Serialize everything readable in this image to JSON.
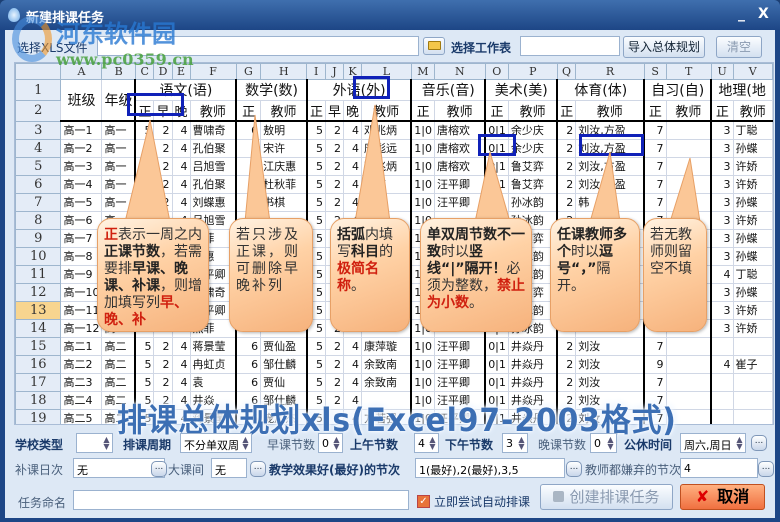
{
  "window": {
    "title": "新建排课任务",
    "minimize": "_",
    "close": "X"
  },
  "watermark": {
    "logo_text": "河东软件园",
    "logo_url": "www.pc0359.cn",
    "overlay": "排课总体规划xls(Excel97-2003格式)"
  },
  "toolbar": {
    "file_label": "选择XLS文件",
    "file_value": "",
    "sheet_label": "选择工作表",
    "sheet_value": "",
    "import_button": "导入总体规划",
    "clear_button": "清空"
  },
  "grid": {
    "col_letters": [
      "A",
      "B",
      "C",
      "D",
      "E",
      "F",
      "G",
      "H",
      "I",
      "J",
      "K",
      "L",
      "M",
      "N",
      "O",
      "P",
      "Q",
      "R",
      "S",
      "T",
      "U",
      "V"
    ],
    "header1": {
      "row": "1",
      "class": "班级",
      "grade": "年级",
      "subjects": [
        "语文(语)",
        "数学(数)",
        "外语(外)",
        "音乐(音)",
        "美术(美)",
        "体育(体)",
        "自习(自)",
        "地理(地"
      ]
    },
    "header2": {
      "row": "2",
      "cells": [
        "正",
        "早",
        "晚",
        "教师",
        "正",
        "教师",
        "正",
        "早",
        "晚",
        "教师",
        "正",
        "教师",
        "正",
        "教师",
        "正",
        "教师",
        "正",
        "教师",
        "正",
        "教师"
      ]
    },
    "selected_row": "13",
    "rows": [
      [
        "3",
        "高一1",
        "高一",
        "5",
        "2",
        "4",
        "曹啸奇",
        "6",
        "敖明",
        "5",
        "2",
        "4",
        "邓兆炳",
        "1|0",
        "唐榕欢",
        "0|1",
        "余少庆",
        "2",
        "刘汝,方盈",
        "7",
        "",
        "3",
        "丁聪"
      ],
      [
        "4",
        "高一2",
        "高一",
        "5",
        "2",
        "4",
        "孔伯聚",
        "6",
        "宋许",
        "5",
        "2",
        "4",
        "唐彪远",
        "1|0",
        "唐榕欢",
        "0|1",
        "余少庆",
        "2",
        "刘汝,方盈",
        "7",
        "",
        "3",
        "孙蝶"
      ],
      [
        "5",
        "高一3",
        "高一",
        "5",
        "2",
        "4",
        "吕旭雪",
        "6",
        "江庆惠",
        "5",
        "2",
        "4",
        "邓兆炳",
        "1|0",
        "唐榕欢",
        "0|1",
        "鲁艾弈",
        "2",
        "刘汝,方盈",
        "7",
        "",
        "3",
        "许娇"
      ],
      [
        "6",
        "高一4",
        "高一",
        "5",
        "2",
        "4",
        "孔伯聚",
        "6",
        "杜秋菲",
        "5",
        "2",
        "4",
        "冯琪",
        "1|0",
        "汪平卿",
        "0|1",
        "鲁艾弈",
        "2",
        "刘汝,方盈",
        "7",
        "",
        "3",
        "许娇"
      ],
      [
        "7",
        "高一5",
        "高一",
        "5",
        "2",
        "4",
        "刘蝶惠",
        "6",
        "书棋",
        "5",
        "2",
        "4",
        "黄瑶",
        "1|0",
        "汪平卿",
        "0|1",
        "孙冰韵",
        "2",
        "韩",
        "7",
        "",
        "3",
        "孙蝶"
      ],
      [
        "8",
        "高一6",
        "高一",
        "5",
        "2",
        "4",
        "吕旭雪",
        "6",
        "",
        "5",
        "2",
        "4",
        "",
        "1|0",
        "",
        "0|1",
        "孙冰韵",
        "2",
        "",
        "7",
        "",
        "3",
        "许娇"
      ],
      [
        "9",
        "高一7",
        "高一",
        "5",
        "2",
        "4",
        "燕菲",
        "6",
        "",
        "5",
        "2",
        "4",
        "",
        "1|0",
        "",
        "0|1",
        "鲁艾弈",
        "2",
        "",
        "7",
        "",
        "3",
        "孙蝶"
      ],
      [
        "10",
        "高一8",
        "高一",
        "5",
        "2",
        "4",
        "蝶惠",
        "6",
        "",
        "5",
        "2",
        "4",
        "",
        "1|0",
        "",
        "0|1",
        "孙冰韵",
        "2",
        "",
        "7",
        "",
        "3",
        "孙蝶"
      ],
      [
        "11",
        "高一9",
        "高一",
        "5",
        "2",
        "4",
        "汪平卿",
        "6",
        "",
        "5",
        "2",
        "4",
        "",
        "1|0",
        "",
        "0|1",
        "孙冰韵",
        "2",
        "",
        "7",
        "",
        "4",
        "丁聪"
      ],
      [
        "12",
        "高一10",
        "高一",
        "5",
        "2",
        "4",
        "曹啸奇",
        "6",
        "",
        "5",
        "2",
        "4",
        "",
        "1|0",
        "",
        "0|1",
        "鲁艾弈",
        "2",
        "",
        "7",
        "",
        "3",
        "孙蝶"
      ],
      [
        "13",
        "高一11",
        "高一",
        "5",
        "2",
        "4",
        "汪平卿",
        "6",
        "",
        "5",
        "2",
        "4",
        "",
        "1|0",
        "",
        "0|1",
        "孙冰韵",
        "2",
        "",
        "7",
        "",
        "3",
        "许娇"
      ],
      [
        "14",
        "高一12",
        "高一",
        "5",
        "2",
        "4",
        "燕菲",
        "6",
        "",
        "5",
        "2",
        "4",
        "",
        "1|0",
        "",
        "0|1",
        "孙冰韵",
        "2",
        "",
        "7",
        "",
        "3",
        "许娇"
      ],
      [
        "15",
        "高二1",
        "高二",
        "5",
        "2",
        "4",
        "蒋景莹",
        "6",
        "贾仙盈",
        "5",
        "2",
        "4",
        "康萍璇",
        "1|0",
        "汪平卿",
        "0|1",
        "井焱丹",
        "2",
        "刘汝",
        "7",
        "",
        "",
        ""
      ],
      [
        "16",
        "高二2",
        "高二",
        "5",
        "2",
        "4",
        "冉虹贞",
        "6",
        "邹仕麟",
        "5",
        "2",
        "4",
        "余致南",
        "1|0",
        "汪平卿",
        "0|1",
        "井焱丹",
        "2",
        "刘汝",
        "9",
        "",
        "4",
        "崔子"
      ],
      [
        "17",
        "高二3",
        "高二",
        "5",
        "2",
        "4",
        "袁",
        "6",
        "贾仙",
        "5",
        "2",
        "4",
        "余致南",
        "1|0",
        "汪平卿",
        "0|1",
        "井焱丹",
        "2",
        "刘汝",
        "7",
        "",
        "",
        ""
      ],
      [
        "18",
        "高二4",
        "高二",
        "5",
        "2",
        "4",
        "井焱",
        "6",
        "邹仕麟",
        "5",
        "2",
        "4",
        "",
        "1|0",
        "汪平卿",
        "0|1",
        "井焱丹",
        "2",
        "刘汝",
        "7",
        "",
        "",
        ""
      ],
      [
        "19",
        "高二5",
        "高二",
        "5",
        "2",
        "4",
        "蒋景莹",
        "6",
        "庞加杰",
        "5",
        "2",
        "4",
        "方若强",
        "1|0",
        "汪平卿",
        "0|1",
        "井焱丹",
        "2",
        "刘汝",
        "7",
        "",
        "",
        ""
      ]
    ]
  },
  "callouts": [
    [
      {
        "t": "正",
        "s": "r"
      },
      {
        "t": "表示一周之内"
      },
      {
        "t": "正课节数",
        "s": "b"
      },
      {
        "t": "，若需要排"
      },
      {
        "t": "早课、晚课、补课",
        "s": "b"
      },
      {
        "t": "，则增加填写列"
      },
      {
        "t": "早、晚、补",
        "s": "r"
      }
    ],
    [
      {
        "t": "若只涉及正课，则可删除早晚补列"
      }
    ],
    [
      {
        "t": "括弧",
        "s": "b"
      },
      {
        "t": "内填写"
      },
      {
        "t": "科目",
        "s": "b"
      },
      {
        "t": "的"
      },
      {
        "t": "极简名称",
        "s": "r"
      },
      {
        "t": "。"
      }
    ],
    [
      {
        "t": "单双周节数不一致",
        "s": "b"
      },
      {
        "t": "时以"
      },
      {
        "t": "竖线“|”",
        "s": "b"
      },
      {
        "t": "隔开！",
        "s": "b"
      },
      {
        "t": "必须为整数，"
      },
      {
        "t": "禁止为小数",
        "s": "r"
      },
      {
        "t": "。"
      }
    ],
    [
      {
        "t": "任课教师多个",
        "s": "b"
      },
      {
        "t": "时以"
      },
      {
        "t": "逗号“，”",
        "s": "b"
      },
      {
        "t": "隔开。"
      }
    ],
    [
      {
        "t": "若无教师则留空不填"
      }
    ]
  ],
  "settings": {
    "school_type_label": "学校类型",
    "school_type_value": "",
    "cycle_label": "排课周期",
    "cycle_value": "不分单双周",
    "early_label": "早课节数",
    "early_value": "0",
    "morning_label": "上午节数",
    "morning_value": "4",
    "afternoon_label": "下午节数",
    "afternoon_value": "3",
    "evening_label": "晚课节数",
    "evening_value": "0",
    "holiday_label": "公休时间",
    "holiday_value": "周六,周日",
    "makeup_label": "补课日次",
    "makeup_value": "无",
    "break_label": "大课间",
    "break_value": "无",
    "best_label": "教学效果好(最好)的节次",
    "best_value": "1(最好),2(最好),3,5",
    "disliked_label": "教师都嫌弃的节次",
    "disliked_value": "4",
    "name_label": "任务命名",
    "name_value": "",
    "auto_label": "立即尝试自动排课",
    "auto_checked": true,
    "create_button": "创建排课任务",
    "cancel_button": "取消"
  }
}
